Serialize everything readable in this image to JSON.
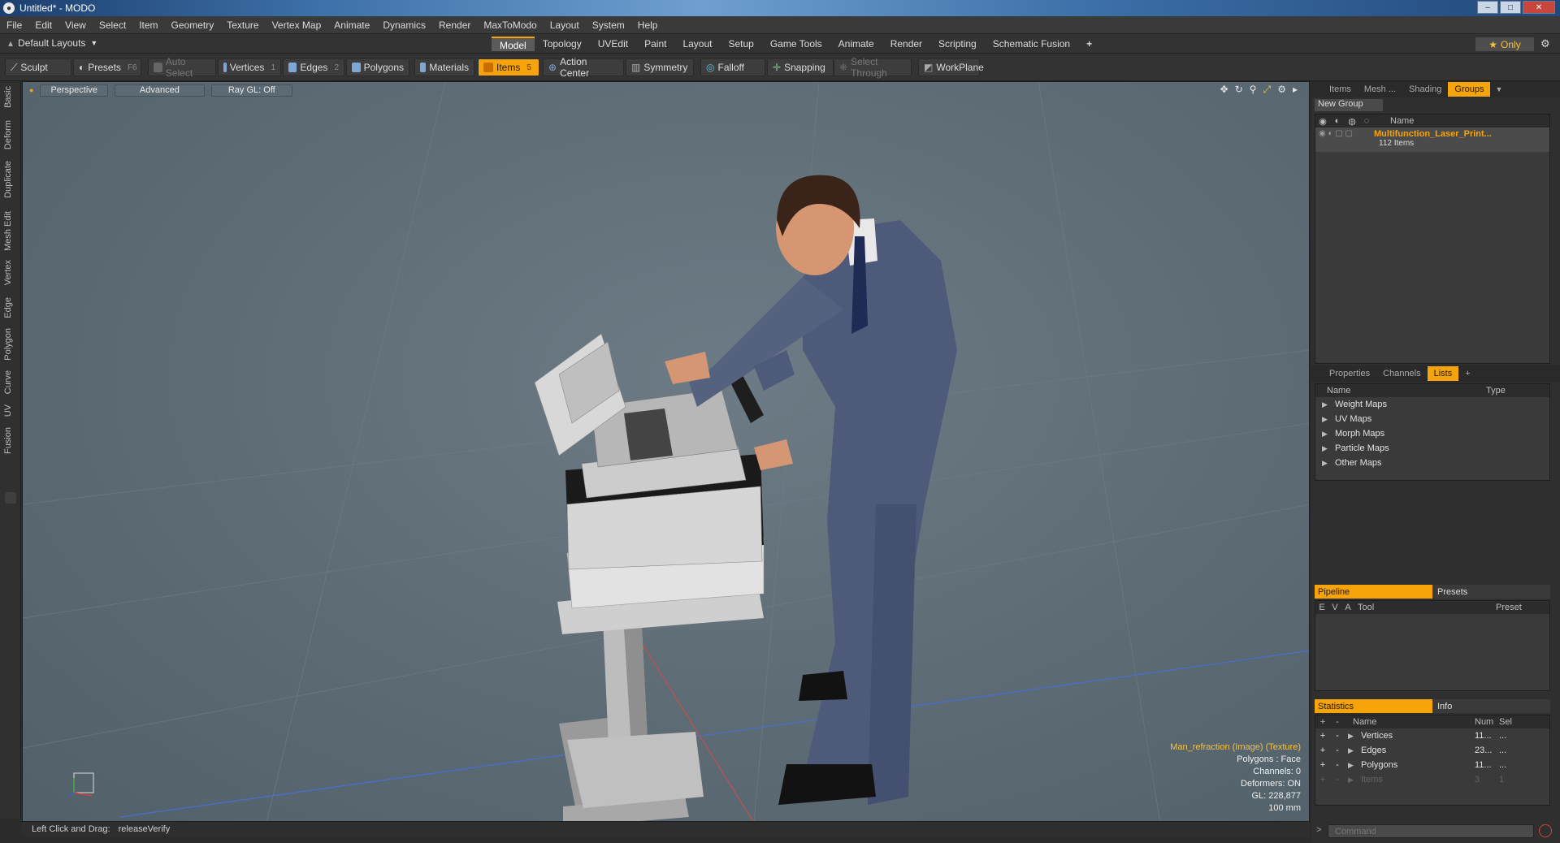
{
  "window": {
    "title": "Untitled* - MODO",
    "app_icon": "modo-logo-icon"
  },
  "menubar": [
    "File",
    "Edit",
    "View",
    "Select",
    "Item",
    "Geometry",
    "Texture",
    "Vertex Map",
    "Animate",
    "Dynamics",
    "Render",
    "MaxToModo",
    "Layout",
    "System",
    "Help"
  ],
  "layoutbar": {
    "layout_selector": "Default Layouts",
    "tabs": [
      "Model",
      "Topology",
      "UVEdit",
      "Paint",
      "Layout",
      "Setup",
      "Game Tools",
      "Animate",
      "Render",
      "Scripting",
      "Schematic Fusion"
    ],
    "active_tab": "Model",
    "add_label": "+",
    "only_label": "Only"
  },
  "toolbar": {
    "sculpt": "Sculpt",
    "presets": "Presets",
    "presets_key": "F6",
    "auto_select": "Auto Select",
    "vertices": "Vertices",
    "vertices_key": "1",
    "edges": "Edges",
    "edges_key": "2",
    "polygons": "Polygons",
    "materials": "Materials",
    "items": "Items",
    "items_key": "5",
    "action_center": "Action Center",
    "symmetry": "Symmetry",
    "falloff": "Falloff",
    "snapping": "Snapping",
    "select_through": "Select Through",
    "workplane": "WorkPlane"
  },
  "left_tabs": [
    "Basic",
    "Deform",
    "Duplicate",
    "Mesh Edit",
    "Vertex",
    "Edge",
    "Polygon",
    "Curve",
    "UV",
    "Fusion"
  ],
  "viewport": {
    "view_mode": "Perspective",
    "shading": "Advanced",
    "raygl": "Ray GL: Off",
    "info": {
      "texture": "Man_refraction (Image) (Texture)",
      "polygons": "Polygons : Face",
      "channels": "Channels: 0",
      "deformers": "Deformers: ON",
      "gl": "GL: 228,877",
      "scale": "100 mm"
    }
  },
  "statusbar": {
    "hint": "Left Click and Drag:",
    "action": "releaseVerify"
  },
  "groups_panel": {
    "tabs": [
      "Items",
      "Mesh ...",
      "Shading",
      "Groups"
    ],
    "active_tab": "Groups",
    "new_group": "New Group",
    "col_name": "Name",
    "group_name": "Multifunction_Laser_Print...",
    "group_count": "112 Items"
  },
  "lists_panel": {
    "tabs": [
      "Properties",
      "Channels",
      "Lists"
    ],
    "active_tab": "Lists",
    "add_label": "+",
    "col_name": "Name",
    "col_type": "Type",
    "items": [
      "Weight Maps",
      "UV Maps",
      "Morph Maps",
      "Particle Maps",
      "Other Maps"
    ]
  },
  "pipeline_panel": {
    "tab_on": "Pipeline",
    "tab_off": "Presets",
    "cols": [
      "E",
      "V",
      "A",
      "Tool",
      "Preset"
    ]
  },
  "stats_panel": {
    "tab_on": "Statistics",
    "tab_off": "Info",
    "cols": [
      "+",
      "-",
      "Name",
      "Num",
      "Sel"
    ],
    "rows": [
      {
        "name": "Vertices",
        "num": "11...",
        "sel": "..."
      },
      {
        "name": "Edges",
        "num": "23...",
        "sel": "..."
      },
      {
        "name": "Polygons",
        "num": "11...",
        "sel": "..."
      },
      {
        "name": "Items",
        "num": "3",
        "sel": "1"
      }
    ]
  },
  "command": {
    "placeholder": "Command"
  },
  "colors": {
    "accent": "#f7a30a",
    "viewport_bg": "#5d6b74",
    "panel_bg": "#2f2f2f"
  }
}
